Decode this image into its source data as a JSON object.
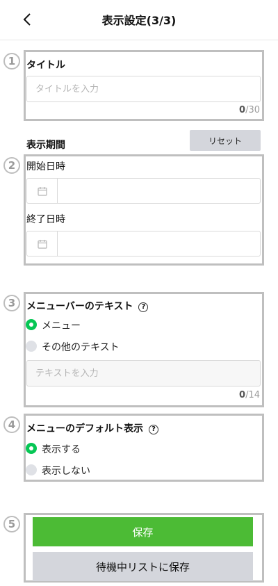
{
  "header": {
    "title": "表示設定(3/3)"
  },
  "markers": [
    "1",
    "2",
    "3",
    "4",
    "5"
  ],
  "title_section": {
    "label": "タイトル",
    "placeholder": "タイトルを入力",
    "count": "0",
    "max": "/30"
  },
  "period": {
    "label": "表示期間",
    "reset_label": "リセット",
    "start_label": "開始日時",
    "end_label": "終了日時"
  },
  "menubar_text": {
    "label": "メニューバーのテキスト",
    "options": [
      "メニュー",
      "その他のテキスト"
    ],
    "selected": "メニュー",
    "placeholder": "テキストを入力",
    "count": "0",
    "max": "/14"
  },
  "default_display": {
    "label": "メニューのデフォルト表示",
    "options": [
      "表示する",
      "表示しない"
    ],
    "selected": "表示する"
  },
  "actions": {
    "save_label": "保存",
    "standby_label": "待機中リストに保存"
  },
  "colors": {
    "accent_green": "#06c755",
    "save_button": "#4cbb35",
    "secondary_button": "#d4d6dc",
    "frame_gray": "#bfbfbf"
  },
  "icons": [
    "chevron-left-icon",
    "calendar-icon",
    "help-icon"
  ]
}
